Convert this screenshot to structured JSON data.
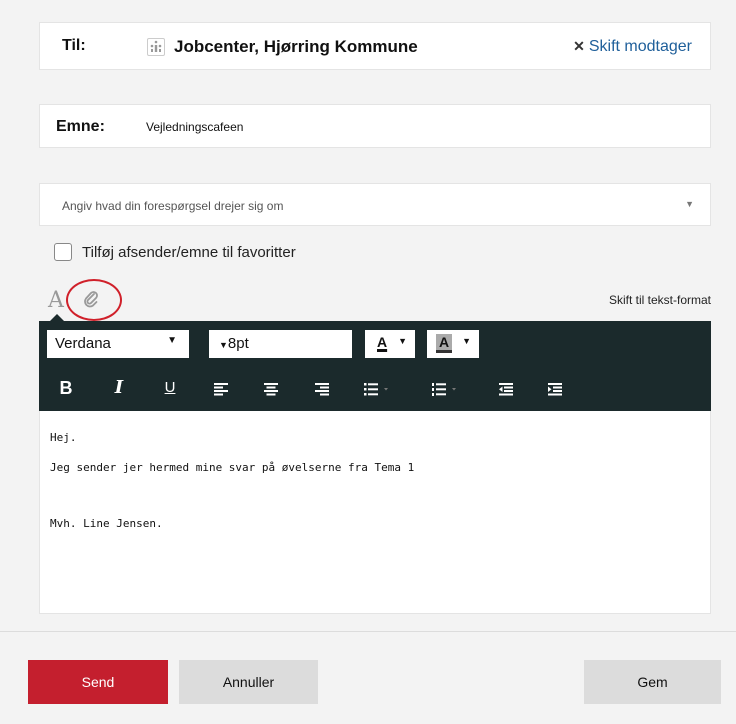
{
  "recipient": {
    "label": "Til:",
    "name": "Jobcenter, Hjørring Kommune",
    "change_label": "Skift modtager"
  },
  "subject": {
    "label": "Emne:",
    "value": "Vejledningscafeen"
  },
  "topic": {
    "placeholder": "Angiv hvad din forespørgsel drejer sig om"
  },
  "favorite": {
    "label": "Tilføj afsender/emne til favoritter",
    "checked": false
  },
  "editor_tabs": {
    "format_icon": "A",
    "switch_label": "Skift til tekst-format"
  },
  "toolbar": {
    "font": "Verdana",
    "size": "8pt",
    "fg_label": "A",
    "bg_label": "A",
    "bold": "B",
    "italic": "I",
    "underline": "U"
  },
  "body": {
    "lines": [
      "Hej.",
      "Jeg sender jer hermed mine svar på øvelserne fra Tema 1",
      "",
      "Mvh. Line Jensen."
    ]
  },
  "actions": {
    "send": "Send",
    "cancel": "Annuller",
    "save": "Gem"
  },
  "colors": {
    "accent": "#c41f2e",
    "toolbar_bg": "#1b2a2c",
    "link": "#1f5f9a",
    "highlight_circle": "#d0202a"
  }
}
